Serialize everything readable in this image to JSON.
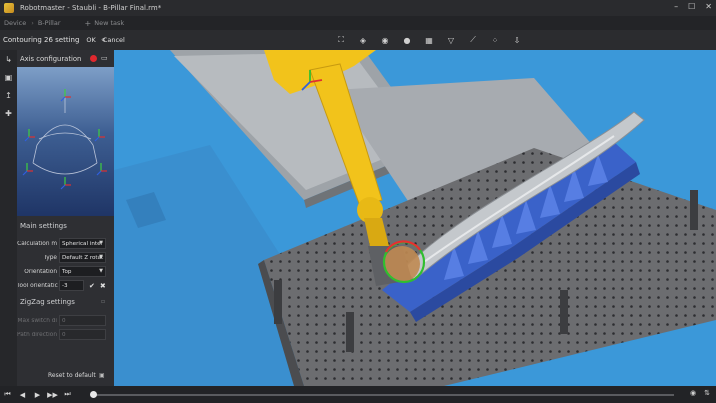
{
  "window": {
    "title": "Robotmaster - Staubli - B-Pillar Final.rm*",
    "controls": {
      "minimize": "–",
      "maximize": "☐",
      "close": "✕"
    }
  },
  "menu": {
    "device": "Device",
    "separator": "›",
    "part": "B-Pillar",
    "new_task": "New task",
    "plus": "+"
  },
  "toolbar": {
    "title": "Contouring 26 setting",
    "ok": "OK",
    "cancel": "Cancel",
    "collapse": "«",
    "view_icons": [
      "fit-view-icon",
      "cube-view-icon",
      "eye-icon",
      "sphere-icon",
      "grid-icon",
      "filter-icon",
      "path-icon",
      "dots-icon",
      "export-icon"
    ]
  },
  "strip_icons": [
    "robot-arm-icon",
    "image-icon",
    "axis-icon",
    "add-icon"
  ],
  "axis_config": {
    "title": "Axis configuration",
    "monitor_icon": "▭"
  },
  "main_settings": {
    "title": "Main settings",
    "calc_label": "Calculation m",
    "calc_value": "Spherical inter",
    "type_label": "Type",
    "type_value": "Default Z rotat",
    "orient_label": "Orientation",
    "orient_value": "Top",
    "tool_label": "Tool orientatic",
    "tool_value": "-3",
    "confirm": "✔",
    "clear": "✖"
  },
  "zigzag": {
    "title": "ZigZag settings",
    "maxswitch_label": "Max switch di",
    "maxswitch_value": "0",
    "pathdir_label": "Path direction",
    "pathdir_value": "0"
  },
  "reset": {
    "label": "Reset to default"
  },
  "playback": {
    "buttons": [
      "⏮",
      "◀",
      "▶",
      "▶▶",
      "⏭"
    ],
    "right_icons": [
      "◉",
      "⇅"
    ],
    "progress": 0.0
  },
  "colors": {
    "accent": "#f2c31b",
    "fixture": "#3a62c9",
    "table_blue": "#3b98d9",
    "red_dot": "#e0282e"
  }
}
